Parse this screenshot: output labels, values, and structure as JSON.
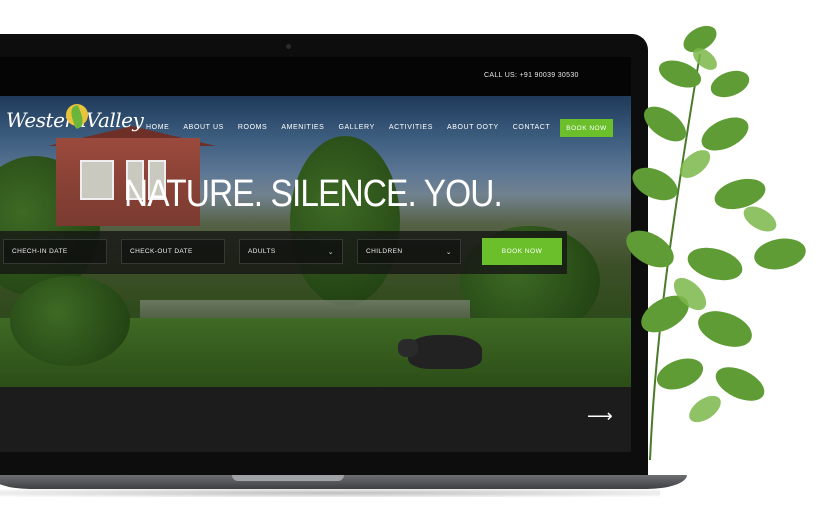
{
  "topbar": {
    "call": "CALL US: +91 90039 30530"
  },
  "logo": {
    "text": "WesternValley"
  },
  "nav": {
    "items": [
      "HOME",
      "ABOUT US",
      "ROOMS",
      "AMENITIES",
      "GALLERY",
      "ACTIVITIES",
      "ABOUT OOTY",
      "CONTACT"
    ],
    "book_label": "BOOK NOW"
  },
  "hero": {
    "headline": "NATURE. SILENCE. YOU."
  },
  "form": {
    "checkin": "CHECH-IN DATE",
    "checkout": "CHECK-OUT DATE",
    "adults": "ADULTS",
    "children": "CHILDREN",
    "book_label": "BOOK NOW"
  },
  "slider": {
    "next_icon": "arrow-right-icon"
  },
  "colors": {
    "accent": "#6abf2a",
    "dark": "#0d0d0d"
  }
}
